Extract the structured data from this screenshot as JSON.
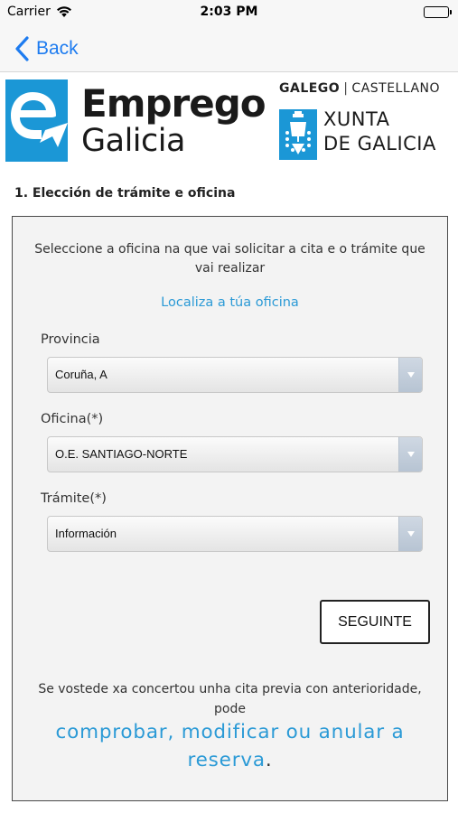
{
  "status_bar": {
    "carrier": "Carrier",
    "time": "2:03 PM",
    "wifi_icon": "wifi-icon",
    "battery_icon": "battery-icon",
    "battery_level": 1.0
  },
  "nav": {
    "back_label": "Back",
    "back_icon": "chevron-left-icon",
    "accent_color": "#1e7cf0"
  },
  "header": {
    "brand_line1": "Emprego",
    "brand_line2": "Galicia",
    "brand_color": "#1b97d6",
    "lang_galego": "GALEGO",
    "lang_separator": "|",
    "lang_castellano": "CASTELLANO",
    "xunta_line1": "XUNTA",
    "xunta_line2": "DE GALICIA"
  },
  "form": {
    "section_title": "1. Elección de trámite e oficina",
    "intro": "Seleccione a oficina na que vai solicitar a cita e o trámite que vai realizar",
    "locate_link": "Localiza a túa oficina",
    "province_label": "Provincia",
    "province_value": "Coruña, A",
    "office_label": "Oficina(*)",
    "office_value": "O.E. SANTIAGO-NORTE",
    "procedure_label": "Trámite(*)",
    "procedure_value": "Información",
    "next_button": "SEGUINTE",
    "existing_note": "Se vostede xa concertou unha cita previa con anterioridade, pode",
    "manage_link": "comprobar, modificar ou anular a reserva",
    "manage_period": ".",
    "link_color": "#2b9ad6"
  }
}
